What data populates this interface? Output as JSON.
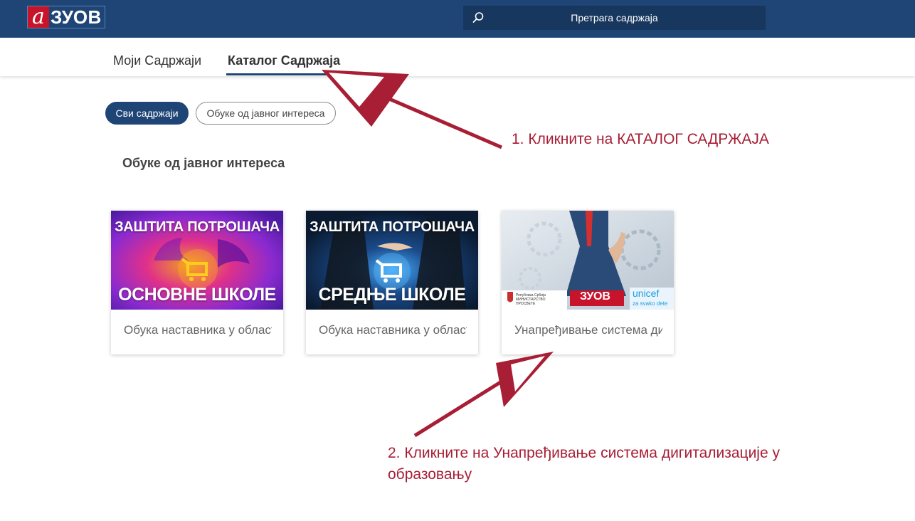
{
  "header": {
    "logo_letter": "а",
    "logo_text": "ЗУОВ",
    "search_placeholder": "Претрага садржаја",
    "search_icon": "search-icon"
  },
  "tabs": [
    {
      "label": "Моји Садржаји",
      "active": false
    },
    {
      "label": "Каталог Садржаја",
      "active": true
    }
  ],
  "filters": [
    {
      "label": "Сви садржаји",
      "active": true
    },
    {
      "label": "Обуке од јавног интереса",
      "active": false
    }
  ],
  "section_title": "Обуке од јавног интереса",
  "cards": [
    {
      "image_top": "ЗАШТИТА ПОТРОШАЧА",
      "image_bottom": "ОСНОВНЕ ШКОЛЕ",
      "caption": "Обука наставника у области заштите потрошача"
    },
    {
      "image_top": "ЗАШТИТА ПОТРОШАЧА",
      "image_bottom": "СРЕДЊЕ ШКОЛЕ",
      "caption": "Обука наставника у области заштите потрошача"
    },
    {
      "image_logo": "ЗУОВ",
      "image_unicef": "unicef",
      "image_unicef_sub": "za svako dete",
      "image_ministry": "Република Србија МИНИСТАРСТВО ПРОСВЕТЕ",
      "caption": "Унапређивање система дигитализације у образовању"
    }
  ],
  "annotations": {
    "step1": "1. Кликните на КАТАЛОГ САДРЖАЈА",
    "step2": "2. Кликните на Унапређивање система дигитализације у образовању"
  },
  "colors": {
    "header_bg": "#1f4576",
    "annotation": "#a71e35",
    "logo_red": "#c8142a"
  }
}
